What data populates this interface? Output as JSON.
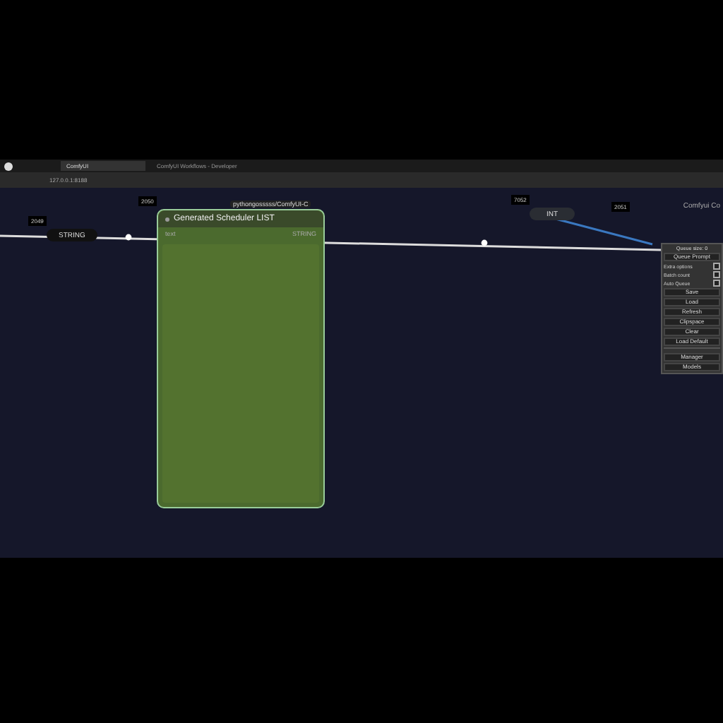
{
  "browser": {
    "tabs": [
      {
        "label": "ComfyUI",
        "selected": true
      },
      {
        "label": "ComfyUI Workflows - Developer",
        "selected": false
      }
    ],
    "address": "127.0.0.1:8188"
  },
  "canvas": {
    "nodes": [
      {
        "kind": "pill",
        "id": "2049",
        "label": "STRING",
        "color": "#111111"
      },
      {
        "kind": "big",
        "id": "2050",
        "badge": "pythongosssss/ComfyUI-C",
        "title": "Generated Scheduler LIST",
        "input": "text",
        "output": "STRING",
        "color": "#4b6a2e"
      },
      {
        "kind": "pill",
        "id": "7052",
        "label": "INT",
        "color": "#2a2d33"
      },
      {
        "kind": "id",
        "id": "2051"
      }
    ],
    "corner_title": "Comfyui Co",
    "menu": {
      "header": "Queue size: 0",
      "queue_button": "Queue Prompt",
      "options": [
        {
          "label": "Extra options",
          "checked": false
        },
        {
          "label": "Batch count",
          "checked": false
        },
        {
          "label": "Auto Queue",
          "checked": false
        }
      ],
      "buttons": [
        "Save",
        "Load",
        "Refresh",
        "Clipspace",
        "Clear",
        "Load Default"
      ],
      "bottom_buttons": [
        "Manager",
        "Models"
      ]
    }
  }
}
